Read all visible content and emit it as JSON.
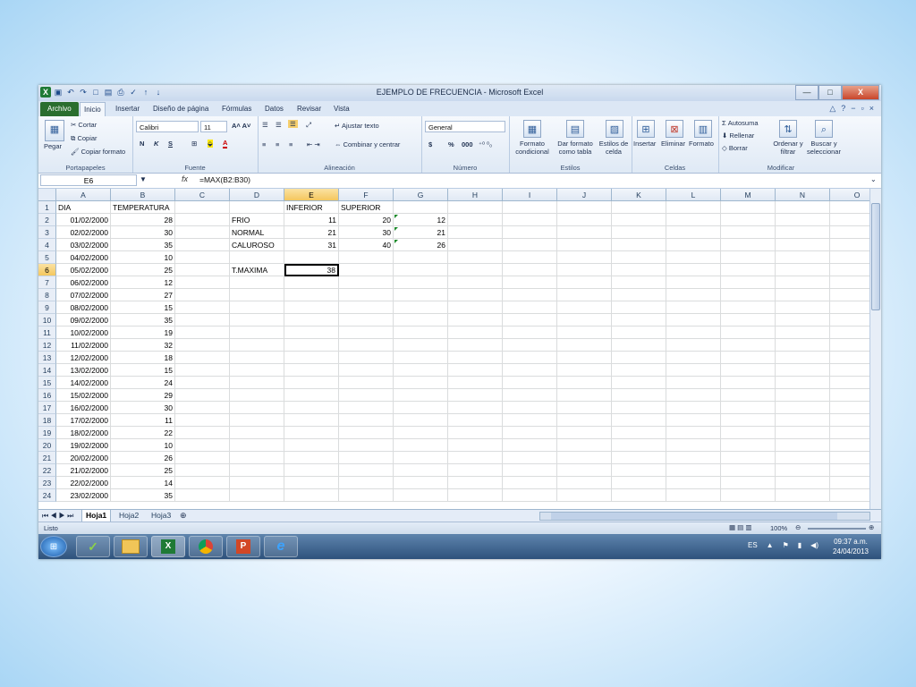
{
  "window": {
    "title": "EJEMPLO DE FRECUENCIA - Microsoft Excel",
    "controls": [
      "—",
      "□",
      "X"
    ]
  },
  "ribbon_tabs": [
    "Archivo",
    "Inicio",
    "Insertar",
    "Diseño de página",
    "Fórmulas",
    "Datos",
    "Revisar",
    "Vista"
  ],
  "active_tab": "Inicio",
  "ribbon": {
    "clipboard": {
      "paste": "Pegar",
      "cut": "Cortar",
      "copy": "Copiar",
      "format_painter": "Copiar formato",
      "label": "Portapapeles"
    },
    "font": {
      "name": "Calibri",
      "size": "11",
      "bold": "N",
      "italic": "K",
      "underline": "S",
      "label": "Fuente"
    },
    "alignment": {
      "wrap": "Ajustar texto",
      "merge": "Combinar y centrar",
      "label": "Alineación"
    },
    "number": {
      "format": "General",
      "currency": "$",
      "percent": "%",
      "thousands": "000",
      "label": "Número"
    },
    "styles": {
      "conditional": "Formato condicional",
      "as_table": "Dar formato como tabla",
      "cell_styles": "Estilos de celda",
      "label": "Estilos"
    },
    "cells": {
      "insert": "Insertar",
      "delete": "Eliminar",
      "format": "Formato",
      "label": "Celdas"
    },
    "editing": {
      "autosum": "Autosuma",
      "fill": "Rellenar",
      "clear": "Borrar",
      "sort": "Ordenar y filtrar",
      "find": "Buscar y seleccionar",
      "label": "Modificar"
    }
  },
  "formula_bar": {
    "name_box": "E6",
    "fx": "fx",
    "formula": "=MAX(B2:B30)"
  },
  "columns": [
    "A",
    "B",
    "C",
    "D",
    "E",
    "F",
    "G",
    "H",
    "I",
    "J",
    "K",
    "L",
    "M",
    "N",
    "O"
  ],
  "rows": [
    [
      "DIA",
      "TEMPERATURA",
      "",
      "",
      "INFERIOR",
      "SUPERIOR",
      "",
      "",
      "",
      "",
      "",
      "",
      "",
      "",
      ""
    ],
    [
      "01/02/2000",
      "28",
      "",
      "FRIO",
      "11",
      "20",
      "12",
      "",
      "",
      "",
      "",
      "",
      "",
      "",
      ""
    ],
    [
      "02/02/2000",
      "30",
      "",
      "NORMAL",
      "21",
      "30",
      "21",
      "",
      "",
      "",
      "",
      "",
      "",
      "",
      ""
    ],
    [
      "03/02/2000",
      "35",
      "",
      "CALUROSO",
      "31",
      "40",
      "26",
      "",
      "",
      "",
      "",
      "",
      "",
      "",
      ""
    ],
    [
      "04/02/2000",
      "10",
      "",
      "",
      "",
      "",
      "",
      "",
      "",
      "",
      "",
      "",
      "",
      "",
      ""
    ],
    [
      "05/02/2000",
      "25",
      "",
      "T.MAXIMA",
      "38",
      "",
      "",
      "",
      "",
      "",
      "",
      "",
      "",
      "",
      ""
    ],
    [
      "06/02/2000",
      "12",
      "",
      "",
      "",
      "",
      "",
      "",
      "",
      "",
      "",
      "",
      "",
      "",
      ""
    ],
    [
      "07/02/2000",
      "27",
      "",
      "",
      "",
      "",
      "",
      "",
      "",
      "",
      "",
      "",
      "",
      "",
      ""
    ],
    [
      "08/02/2000",
      "15",
      "",
      "",
      "",
      "",
      "",
      "",
      "",
      "",
      "",
      "",
      "",
      "",
      ""
    ],
    [
      "09/02/2000",
      "35",
      "",
      "",
      "",
      "",
      "",
      "",
      "",
      "",
      "",
      "",
      "",
      "",
      ""
    ],
    [
      "10/02/2000",
      "19",
      "",
      "",
      "",
      "",
      "",
      "",
      "",
      "",
      "",
      "",
      "",
      "",
      ""
    ],
    [
      "11/02/2000",
      "32",
      "",
      "",
      "",
      "",
      "",
      "",
      "",
      "",
      "",
      "",
      "",
      "",
      ""
    ],
    [
      "12/02/2000",
      "18",
      "",
      "",
      "",
      "",
      "",
      "",
      "",
      "",
      "",
      "",
      "",
      "",
      ""
    ],
    [
      "13/02/2000",
      "15",
      "",
      "",
      "",
      "",
      "",
      "",
      "",
      "",
      "",
      "",
      "",
      "",
      ""
    ],
    [
      "14/02/2000",
      "24",
      "",
      "",
      "",
      "",
      "",
      "",
      "",
      "",
      "",
      "",
      "",
      "",
      ""
    ],
    [
      "15/02/2000",
      "29",
      "",
      "",
      "",
      "",
      "",
      "",
      "",
      "",
      "",
      "",
      "",
      "",
      ""
    ],
    [
      "16/02/2000",
      "30",
      "",
      "",
      "",
      "",
      "",
      "",
      "",
      "",
      "",
      "",
      "",
      "",
      ""
    ],
    [
      "17/02/2000",
      "11",
      "",
      "",
      "",
      "",
      "",
      "",
      "",
      "",
      "",
      "",
      "",
      "",
      ""
    ],
    [
      "18/02/2000",
      "22",
      "",
      "",
      "",
      "",
      "",
      "",
      "",
      "",
      "",
      "",
      "",
      "",
      ""
    ],
    [
      "19/02/2000",
      "10",
      "",
      "",
      "",
      "",
      "",
      "",
      "",
      "",
      "",
      "",
      "",
      "",
      ""
    ],
    [
      "20/02/2000",
      "26",
      "",
      "",
      "",
      "",
      "",
      "",
      "",
      "",
      "",
      "",
      "",
      "",
      ""
    ],
    [
      "21/02/2000",
      "25",
      "",
      "",
      "",
      "",
      "",
      "",
      "",
      "",
      "",
      "",
      "",
      "",
      ""
    ],
    [
      "22/02/2000",
      "14",
      "",
      "",
      "",
      "",
      "",
      "",
      "",
      "",
      "",
      "",
      "",
      "",
      ""
    ],
    [
      "23/02/2000",
      "35",
      "",
      "",
      "",
      "",
      "",
      "",
      "",
      "",
      "",
      "",
      "",
      "",
      ""
    ]
  ],
  "active_cell": "E6",
  "sheets": [
    "Hoja1",
    "Hoja2",
    "Hoja3"
  ],
  "active_sheet": "Hoja1",
  "status": {
    "mode": "Listo",
    "zoom": "100%"
  },
  "taskbar": {
    "apps": [
      "start-orb",
      "app-green",
      "file-explorer",
      "excel",
      "chrome",
      "powerpoint",
      "internet-explorer"
    ],
    "lang": "ES",
    "time": "09:37 a.m.",
    "date": "24/04/2013"
  },
  "colors": {
    "file_tab": "#2a6e2e",
    "selected_header": "#f4c75e",
    "taskbar": "#2e527c"
  }
}
